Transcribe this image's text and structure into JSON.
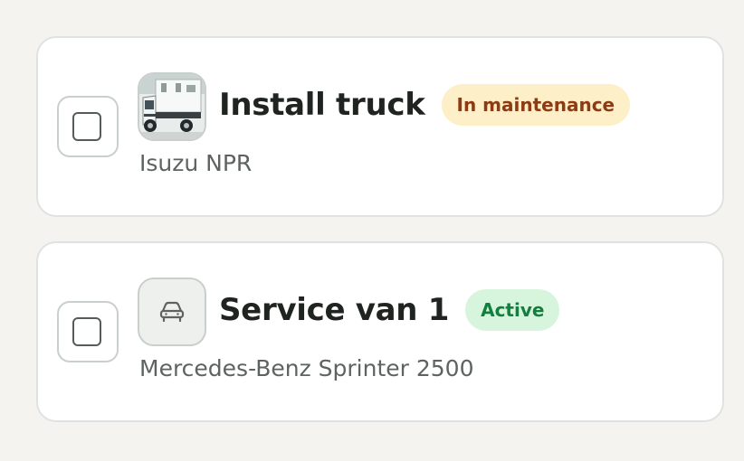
{
  "colors": {
    "background": "#f4f3ef",
    "card": "#ffffff",
    "card_border": "#dfe3df",
    "title_text": "#1f2421",
    "subtitle_text": "#5d6360"
  },
  "vehicles": [
    {
      "name": "Install truck",
      "status": "In maintenance",
      "status_bg": "#fdefc8",
      "status_color": "#8e3a12",
      "model": "Isuzu NPR",
      "thumbnail": "truck-photo",
      "selected": false
    },
    {
      "name": "Service van 1",
      "status": "Active",
      "status_bg": "#d6f5dc",
      "status_color": "#127f3e",
      "model": "Mercedes-Benz Sprinter 2500",
      "thumbnail": "car-icon",
      "selected": false
    }
  ]
}
